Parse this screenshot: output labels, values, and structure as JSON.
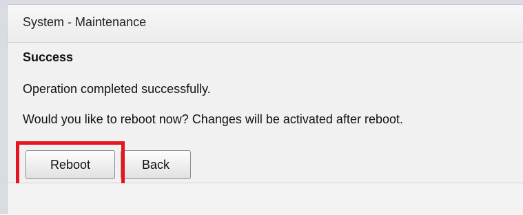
{
  "window": {
    "title": "System - Maintenance"
  },
  "content": {
    "heading": "Success",
    "message": "Operation completed successfully.",
    "prompt": "Would you like to reboot now? Changes will be activated after reboot."
  },
  "buttons": {
    "reboot_label": "Reboot",
    "back_label": "Back"
  },
  "annotation": {
    "highlight_color": "#e4151f",
    "highlighted_element": "reboot-button"
  }
}
